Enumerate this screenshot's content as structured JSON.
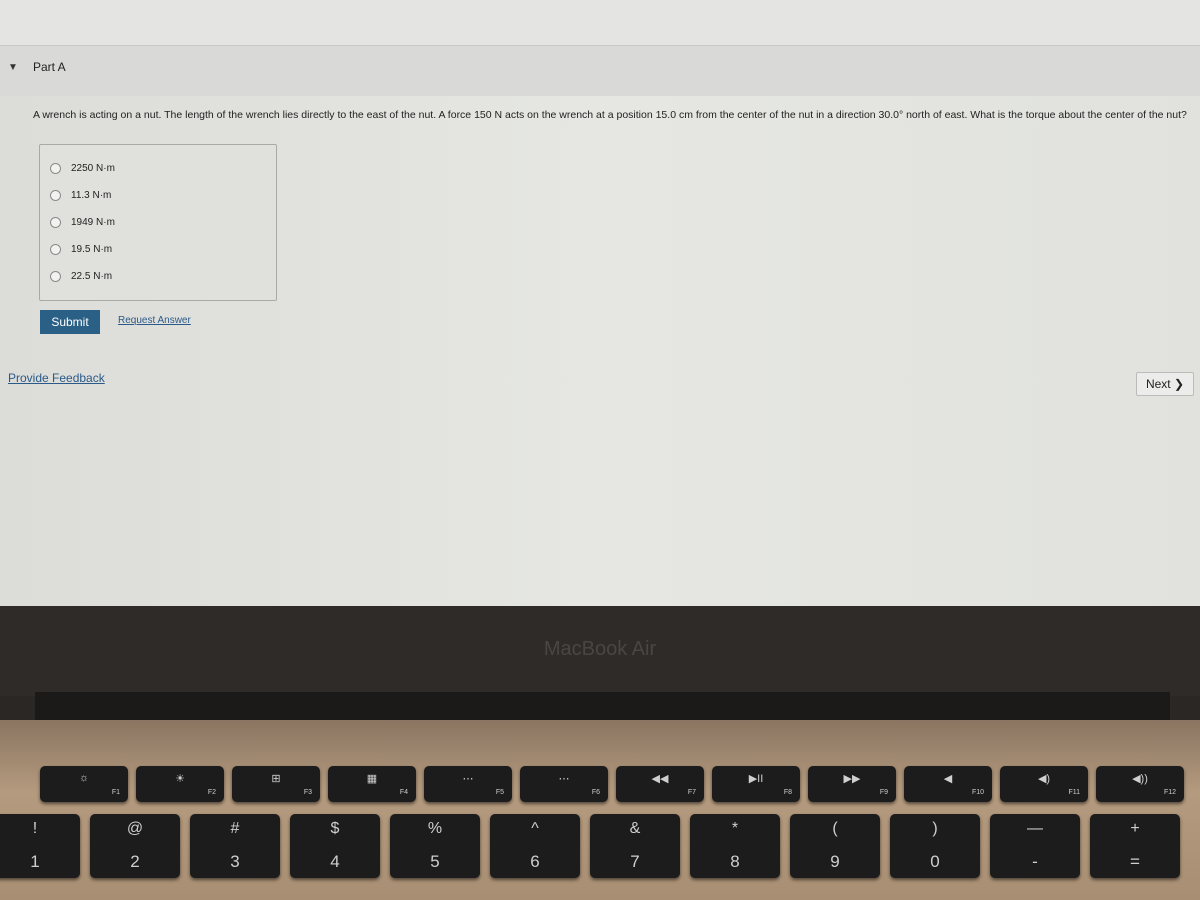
{
  "part": {
    "label": "Part A"
  },
  "question": "A wrench is acting on a nut. The length of the wrench lies directly to the east of the nut. A force 150 N acts on the wrench at a position 15.0 cm from the center of the nut in a direction 30.0° north of east. What is the torque about the center of the nut?",
  "options": [
    "2250 N·m",
    "11.3 N·m",
    "1949 N·m",
    "19.5 N·m",
    "22.5 N·m"
  ],
  "submit_label": "Submit",
  "request_answer_label": "Request Answer",
  "feedback_label": "Provide Feedback",
  "next_label": "Next ❯",
  "brand": "MacBook Air",
  "fkeys": [
    {
      "i": "☼",
      "f": "F1"
    },
    {
      "i": "☀",
      "f": "F2"
    },
    {
      "i": "⊞",
      "f": "F3"
    },
    {
      "i": "▦",
      "f": "F4"
    },
    {
      "i": "⋯",
      "f": "F5"
    },
    {
      "i": "⋯",
      "f": "F6"
    },
    {
      "i": "◀◀",
      "f": "F7"
    },
    {
      "i": "▶II",
      "f": "F8"
    },
    {
      "i": "▶▶",
      "f": "F9"
    },
    {
      "i": "◀",
      "f": "F10"
    },
    {
      "i": "◀)",
      "f": "F11"
    },
    {
      "i": "◀))",
      "f": "F12"
    }
  ],
  "numkeys": [
    {
      "t": "!",
      "b": "1"
    },
    {
      "t": "@",
      "b": "2"
    },
    {
      "t": "#",
      "b": "3"
    },
    {
      "t": "$",
      "b": "4"
    },
    {
      "t": "%",
      "b": "5"
    },
    {
      "t": "^",
      "b": "6"
    },
    {
      "t": "&",
      "b": "7"
    },
    {
      "t": "*",
      "b": "8"
    },
    {
      "t": "(",
      "b": "9"
    },
    {
      "t": ")",
      "b": "0"
    },
    {
      "t": "—",
      "b": "-"
    },
    {
      "t": "+",
      "b": "="
    }
  ]
}
